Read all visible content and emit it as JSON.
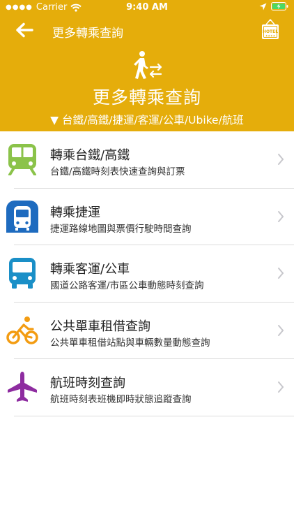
{
  "status_bar": {
    "carrier": "Carrier",
    "time": "9:40 AM"
  },
  "nav": {
    "title": "更多轉乘查詢",
    "back_icon": "arrow-left-icon",
    "hotel_icon": "hotel-sign-icon"
  },
  "hero": {
    "icon": "walking-transfer-icon",
    "title": "更多轉乘查詢",
    "subtitle": "▼ 台鐵/高鐵/捷運/客運/公車/Ubike/航班"
  },
  "colors": {
    "header_bg": "#e5ad0b",
    "train": "#8bc34a",
    "metro": "#1e6bbf",
    "bus": "#1a8fc7",
    "bike": "#f39c12",
    "flight": "#8e2ca0"
  },
  "items": [
    {
      "icon": "train-icon",
      "title": "轉乘台鐵/高鐵",
      "desc": "台鐵/高鐵時刻表快速查詢與訂票"
    },
    {
      "icon": "metro-icon",
      "title": "轉乘捷運",
      "desc": "捷運路線地圖與票價行駛時間查詢"
    },
    {
      "icon": "bus-icon",
      "title": "轉乘客運/公車",
      "desc": "國道公路客運/市區公車動態時刻查詢"
    },
    {
      "icon": "bicycle-icon",
      "title": "公共單車租借查詢",
      "desc": "公共單車租借站點與車輛數量動態查詢"
    },
    {
      "icon": "airplane-icon",
      "title": "航班時刻查詢",
      "desc": "航班時刻表班機即時狀態追蹤查詢"
    }
  ]
}
